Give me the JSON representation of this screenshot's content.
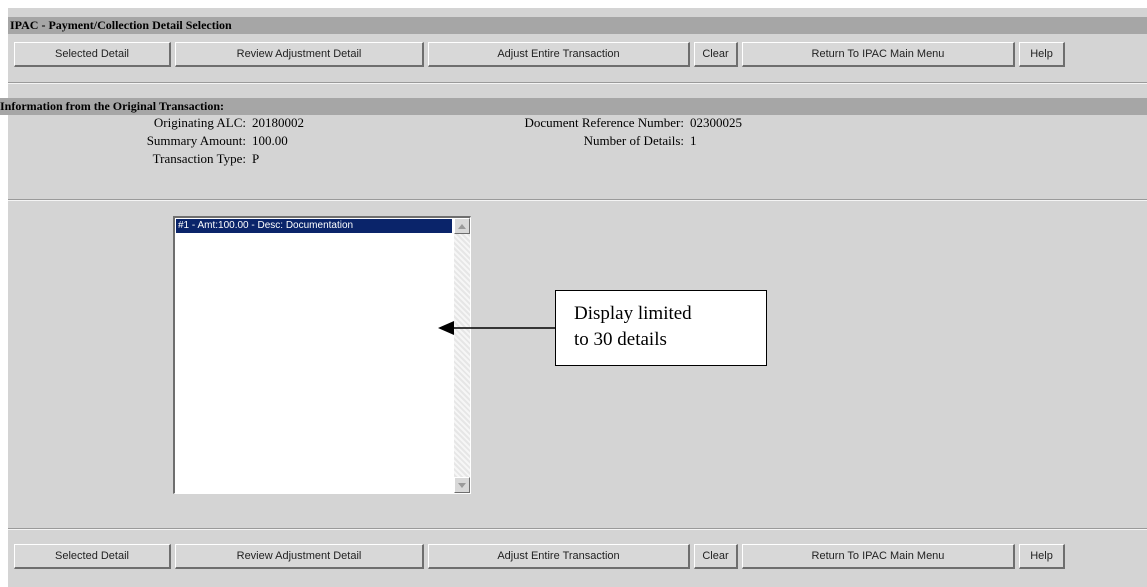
{
  "title": "IPAC - Payment/Collection Detail Selection",
  "toolbar": {
    "selected_detail": "Selected Detail",
    "review_adjustment_detail": "Review Adjustment Detail",
    "adjust_entire_transaction": "Adjust Entire Transaction",
    "clear": "Clear",
    "return_main_menu": "Return To IPAC Main Menu",
    "help": "Help"
  },
  "original": {
    "heading": "Information from the Original Transaction:",
    "originating_alc_label": "Originating ALC:",
    "originating_alc_value": "20180002",
    "summary_amount_label": "Summary Amount:",
    "summary_amount_value": "100.00",
    "transaction_type_label": "Transaction Type:",
    "transaction_type_value": "P",
    "doc_ref_label": "Document Reference Number:",
    "doc_ref_value": "02300025",
    "num_details_label": "Number of Details:",
    "num_details_value": "1"
  },
  "details_list": {
    "items": [
      "#1 - Amt:100.00 - Desc: Documentation"
    ]
  },
  "callout": {
    "line1": "Display limited",
    "line2": "to 30 details"
  },
  "colors": {
    "header_bar": "#a6a6a6",
    "panel": "#d4d4d4",
    "selection": "#0a246a"
  }
}
